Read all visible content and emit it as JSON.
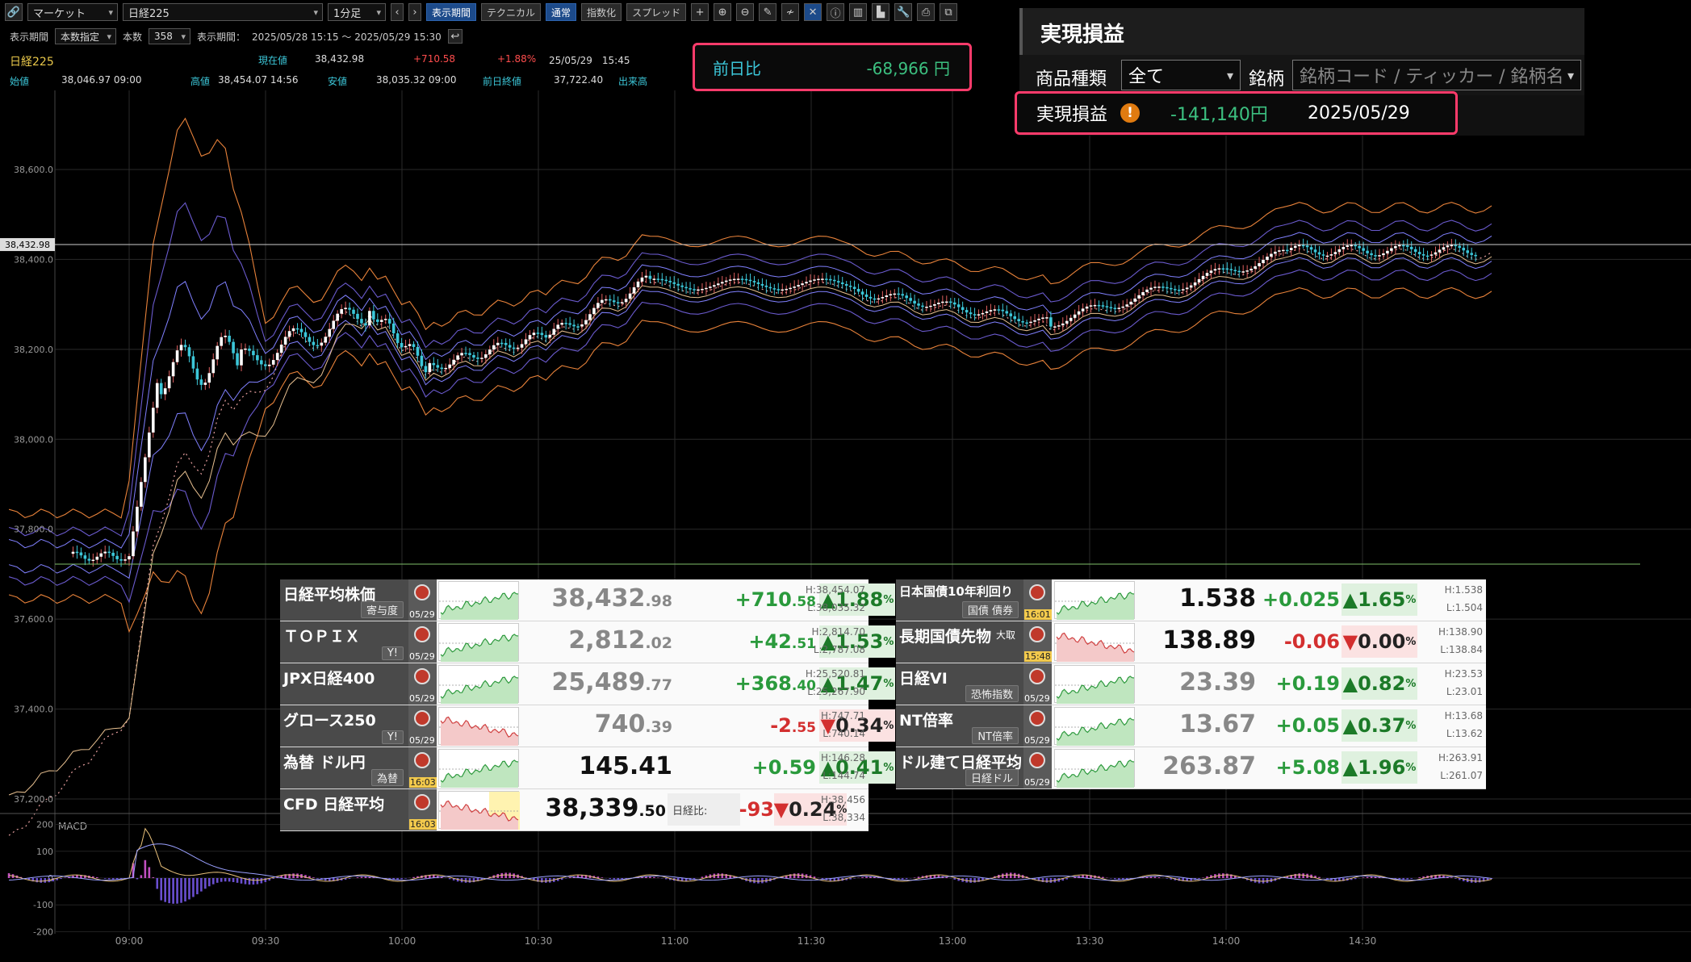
{
  "toolbar": {
    "market_select": "マーケット",
    "symbol_select": "日経225",
    "interval_select": "1分足",
    "btn_display_period": "表示期間",
    "btn_technical": "テクニカル",
    "btn_normal": "通常",
    "btn_index": "指数化",
    "btn_spread": "スプレッド"
  },
  "period_bar": {
    "label_period": "表示期間",
    "period_mode": "本数指定",
    "label_count": "本数",
    "count_value": "358",
    "label_range": "表示期間：",
    "range_value": "2025/05/28 15:15 ～ 2025/05/29 15:30"
  },
  "quote": {
    "symbol": "日経225",
    "label_current": "現在値",
    "current": "38,432.98",
    "change": "+710.58",
    "change_pct": "+1.88%",
    "datetime": "25/05/29　15:45",
    "label_open": "始値",
    "open": "38,046.97 09:00",
    "label_high": "高値",
    "high": "38,454.07 14:56",
    "label_low": "安値",
    "low": "38,035.32 09:00",
    "label_prev": "前日終値",
    "prev": "37,722.40",
    "label_volume": "出来高"
  },
  "day_change_box": {
    "label": "前日比",
    "value": "-68,966 円"
  },
  "realized_panel": {
    "title": "実現損益",
    "label_product": "商品種類",
    "product_value": "全て",
    "label_stock": "銘柄",
    "stock_placeholder": "銘柄コード / ティッカー / 銘柄名",
    "label_realized": "実現損益",
    "realized_value": "-141,140円",
    "realized_date": "2025/05/29"
  },
  "chart": {
    "price_label": "38,432.98",
    "y_ticks": [
      "38,600.0",
      "38,400.0",
      "38,200.0",
      "38,000.0",
      "37,800.0",
      "37,600.0",
      "37,400.0",
      "37,200.0"
    ],
    "x_ticks": [
      "09:00",
      "09:30",
      "10:00",
      "10:30",
      "11:00",
      "11:30",
      "13:00",
      "13:30",
      "14:00",
      "14:30"
    ],
    "macd_label": "MACD",
    "macd_ticks": [
      "200",
      "100",
      "0",
      "-100",
      "-200"
    ],
    "colors": {
      "candle_up": "#ffffff",
      "candle_dn": "#3cc7d9",
      "bb_outer": "#e8823a",
      "bb_inner": "#6a5acd",
      "ma": "#e8a0a0",
      "macd_hist": "#c04fc0"
    }
  },
  "board_left": [
    {
      "name": "日経平均株価",
      "sub": "寄与度",
      "date": "05/29",
      "price_main": "38,432",
      "price_dec": ".98",
      "change_main": "+710",
      "change_dec": ".58",
      "pct": "1.88",
      "dir": "up",
      "high": "H:38,454.07",
      "low": "L:38,035.32"
    },
    {
      "name": "ＴＯＰＩＸ",
      "sub": "Y!",
      "date": "05/29",
      "price_main": "2,812",
      "price_dec": ".02",
      "change_main": "+42",
      "change_dec": ".51",
      "pct": "1.53",
      "dir": "up",
      "high": "H:2,814.70",
      "low": "L:2,787.08"
    },
    {
      "name": "JPX日経400",
      "sub": "",
      "date": "05/29",
      "price_main": "25,489",
      "price_dec": ".77",
      "change_main": "+368",
      "change_dec": ".40",
      "pct": "1.47",
      "dir": "up",
      "high": "H:25,520.81",
      "low": "L:25,267.90"
    },
    {
      "name": "グロース250",
      "sub": "Y!",
      "date": "05/29",
      "price_main": "740",
      "price_dec": ".39",
      "change_main": "-2",
      "change_dec": ".55",
      "pct": "0.34",
      "dir": "dn",
      "high": "H:747.71",
      "low": "L:740.14"
    },
    {
      "name": "為替 ドル円",
      "sub": "為替",
      "date": "16:03",
      "price_main": "145.41",
      "price_dec": "",
      "change_main": "+0.59",
      "change_dec": "",
      "pct": "0.41",
      "dir": "up",
      "high": "H:146.28",
      "low": "L:144.74"
    },
    {
      "name": "CFD 日経平均",
      "sub": "",
      "date": "16:03",
      "price_main": "38,339",
      "price_dec": ".50",
      "change_label": "日経比:",
      "change_main": "-93",
      "change_dec": "",
      "pct": "0.24",
      "dir": "dn",
      "high": "H:38,456",
      "low": "L:38,334"
    }
  ],
  "board_right": [
    {
      "name": "日本国債10年利回り",
      "sub": "国債 債券",
      "date": "16:01",
      "price": "1.538",
      "change": "+0.025",
      "pct": "1.65",
      "dir": "up",
      "high": "H:1.538",
      "low": "L:1.504"
    },
    {
      "name": "長期国債先物",
      "name_small": "大取",
      "sub": "",
      "date": "15:48",
      "price": "138.89",
      "change": "-0.06",
      "pct": "0.00",
      "dir": "dn",
      "high": "H:138.90",
      "low": "L:138.84"
    },
    {
      "name": "日経VI",
      "sub": "恐怖指数",
      "date": "05/29",
      "price": "23.39",
      "change": "+0.19",
      "pct": "0.82",
      "dir": "up",
      "high": "H:23.53",
      "low": "L:23.01"
    },
    {
      "name": "NT倍率",
      "sub": "NT倍率",
      "date": "05/29",
      "price": "13.67",
      "change": "+0.05",
      "pct": "0.37",
      "dir": "up",
      "high": "H:13.68",
      "low": "L:13.62"
    },
    {
      "name": "ドル建て日経平均",
      "sub": "日経ドル",
      "date": "05/29",
      "price": "263.87",
      "change": "+5.08",
      "pct": "1.96",
      "dir": "up",
      "high": "H:263.91",
      "low": "L:261.07"
    }
  ]
}
